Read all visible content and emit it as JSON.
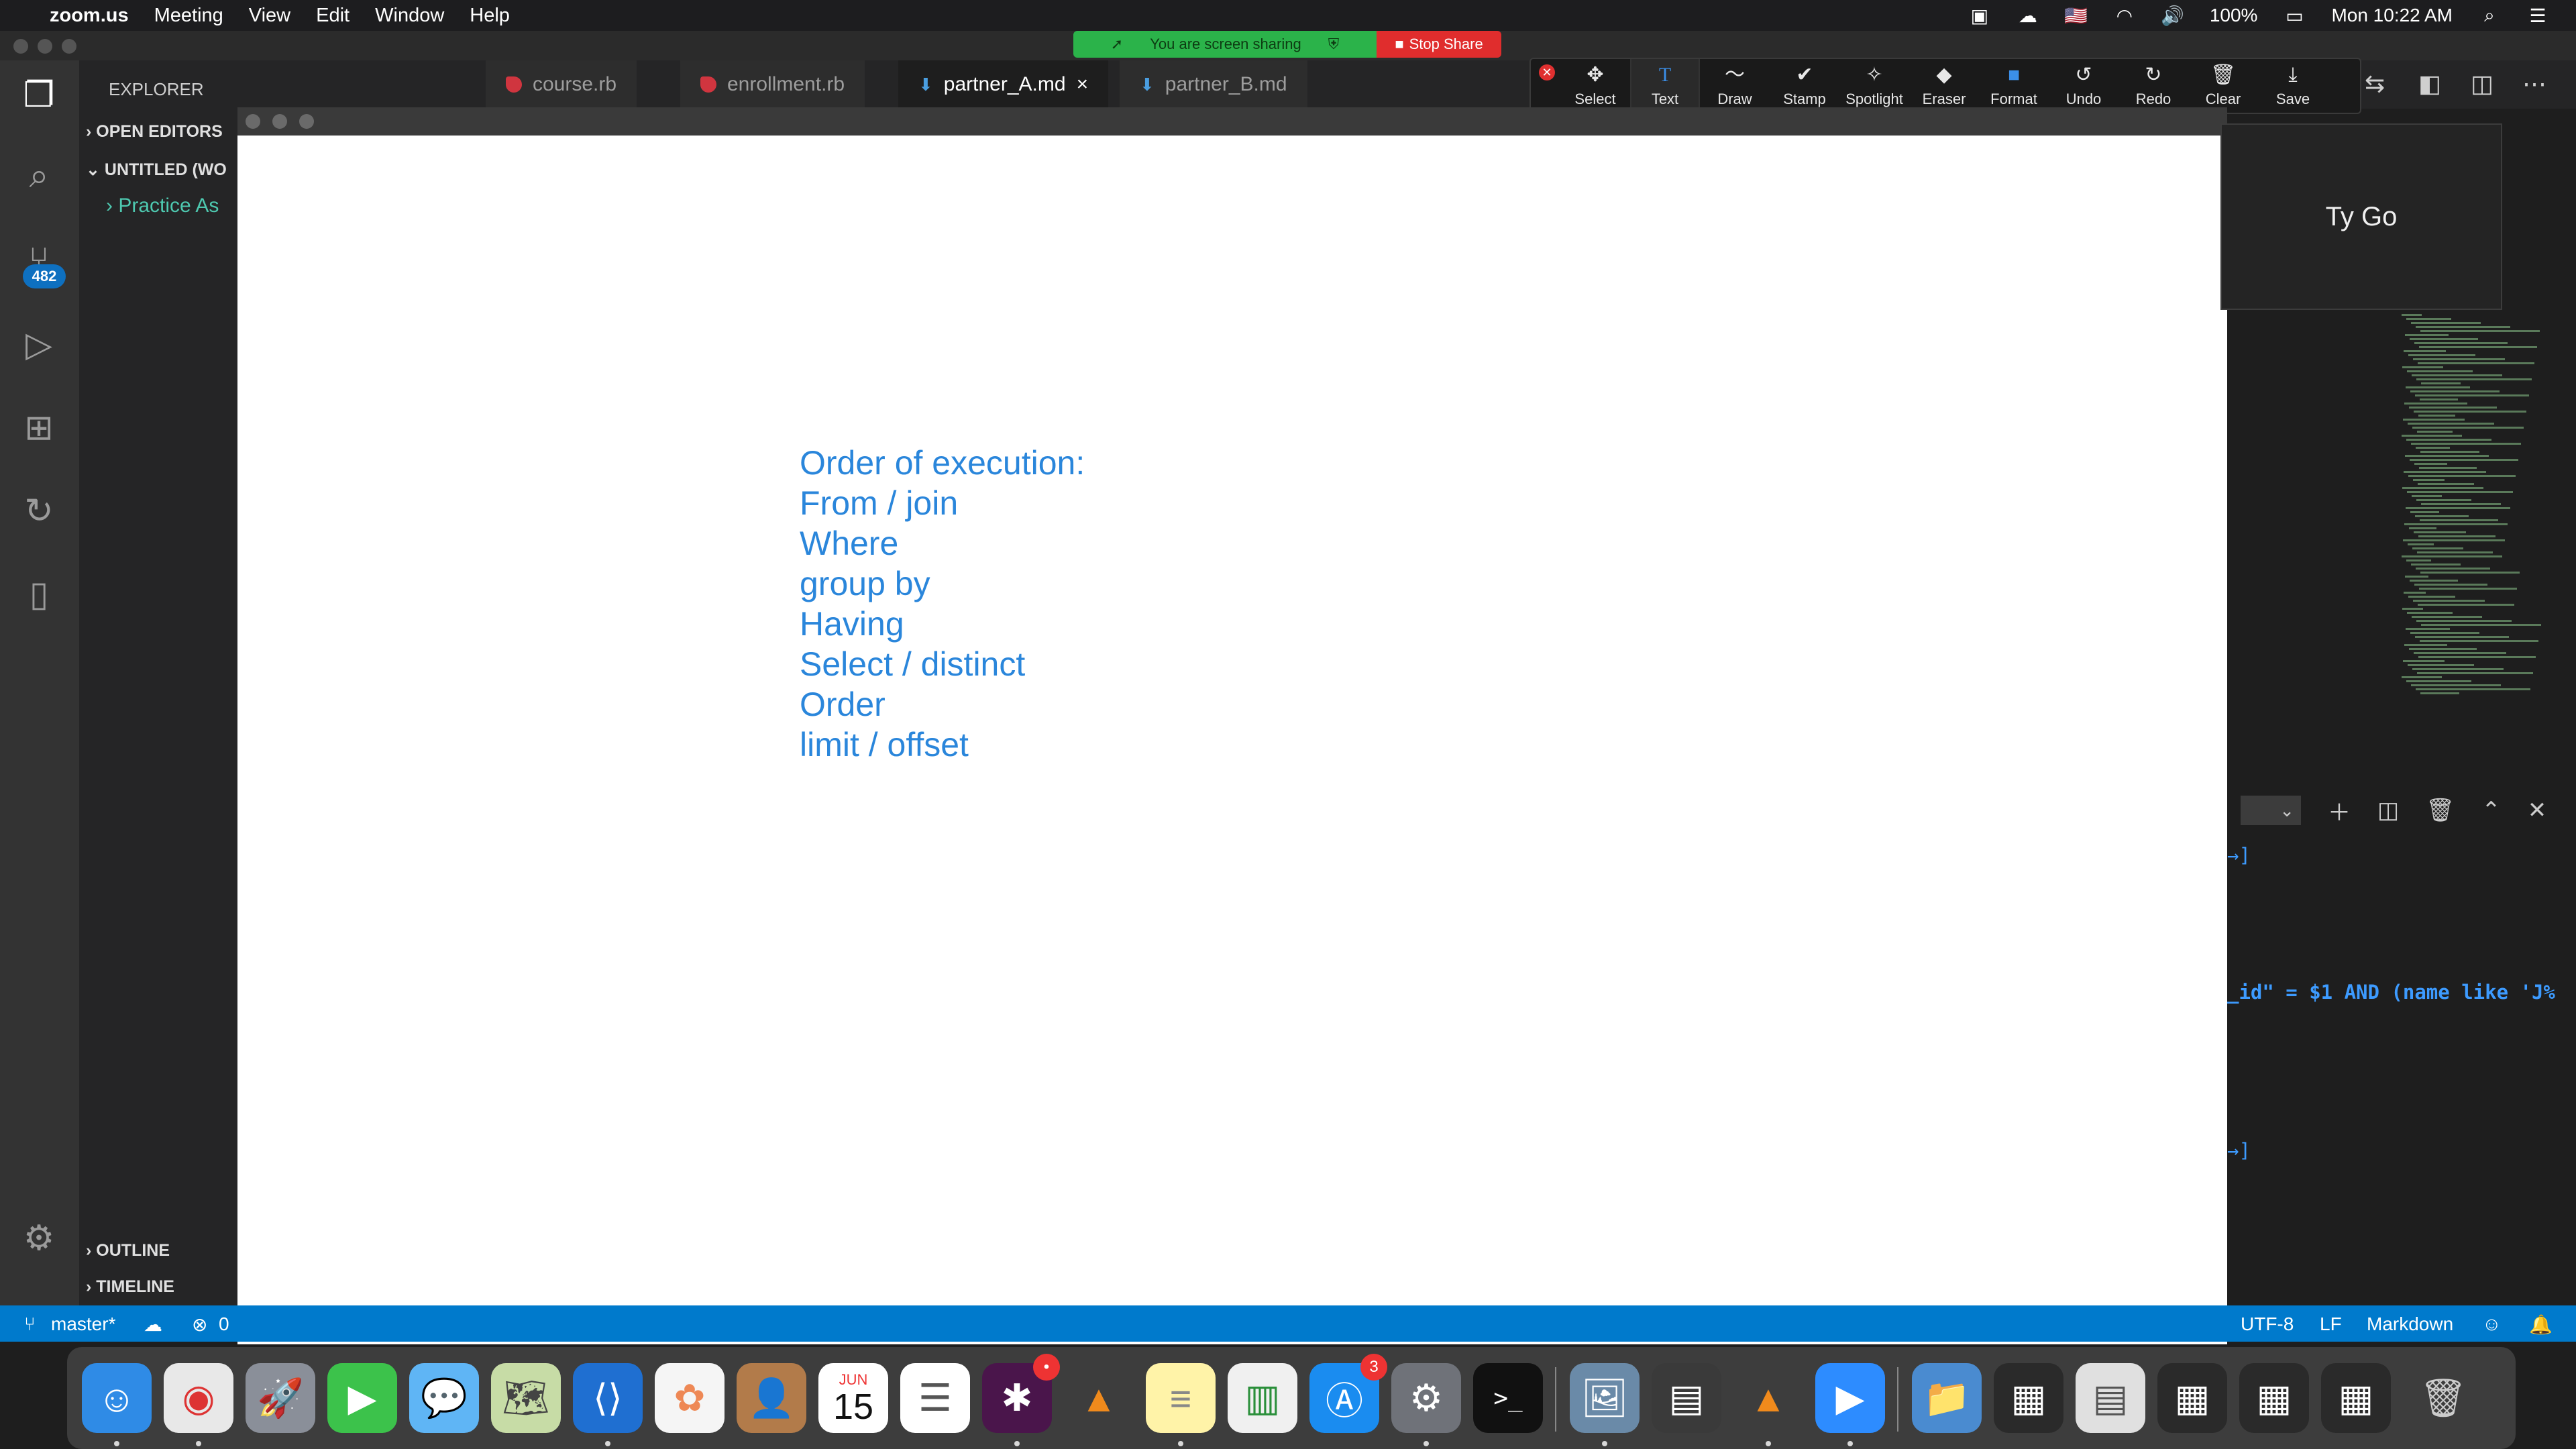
{
  "menubar": {
    "app_name": "zoom.us",
    "menus": [
      "Meeting",
      "View",
      "Edit",
      "Window",
      "Help"
    ],
    "battery": "100%",
    "clock": "Mon 10:22 AM"
  },
  "share_banner": {
    "sharing_text": "You are screen sharing",
    "stop_label": "Stop Share"
  },
  "sidebar": {
    "header": "EXPLORER",
    "open_editors": "OPEN EDITORS",
    "workspace": "UNTITLED (WO",
    "folder": "Practice As",
    "outline": "OUTLINE",
    "timeline": "TIMELINE",
    "scm_badge": "482"
  },
  "tabs": [
    {
      "label": "course.rb",
      "icon": "ruby-icon"
    },
    {
      "label": "enrollment.rb",
      "icon": "ruby-icon"
    },
    {
      "label": "partner_A.md",
      "icon": "markdown-icon",
      "close": "×"
    },
    {
      "label": "partner_B.md",
      "icon": "markdown-icon"
    }
  ],
  "annotation_toolbar": {
    "tools": [
      {
        "label": "Select",
        "icon": "✥"
      },
      {
        "label": "Text",
        "icon": "T"
      },
      {
        "label": "Draw",
        "icon": "〜"
      },
      {
        "label": "Stamp",
        "icon": "✔"
      },
      {
        "label": "Spotlight",
        "icon": "✧"
      },
      {
        "label": "Eraser",
        "icon": "◆"
      },
      {
        "label": "Format",
        "icon": "■"
      },
      {
        "label": "Undo",
        "icon": "↺"
      },
      {
        "label": "Redo",
        "icon": "↻"
      },
      {
        "label": "Clear",
        "icon": "🗑"
      },
      {
        "label": "Save",
        "icon": "⤓"
      }
    ]
  },
  "whiteboard": {
    "lines": [
      "Order of execution:",
      "From / join",
      "Where",
      "group by",
      "Having",
      "Select / distinct",
      "Order",
      "limit / offset"
    ],
    "text_color": "#2a86db"
  },
  "participant": {
    "name": "Ty Go"
  },
  "terminal": {
    "line1": "→]",
    "line2": "_id\" = $1 AND (name like 'J%",
    "line3": "→]"
  },
  "statusbar": {
    "branch": "master*",
    "errors": "0",
    "encoding": "UTF-8",
    "eol": "LF",
    "language": "Markdown"
  },
  "dock": {
    "calendar_month": "JUN",
    "calendar_day": "15",
    "slack_badge": "•",
    "appstore_badge": "3"
  },
  "colors": {
    "accent": "#007acc",
    "share_green": "#2bb34a",
    "stop_red": "#e02d2d"
  }
}
